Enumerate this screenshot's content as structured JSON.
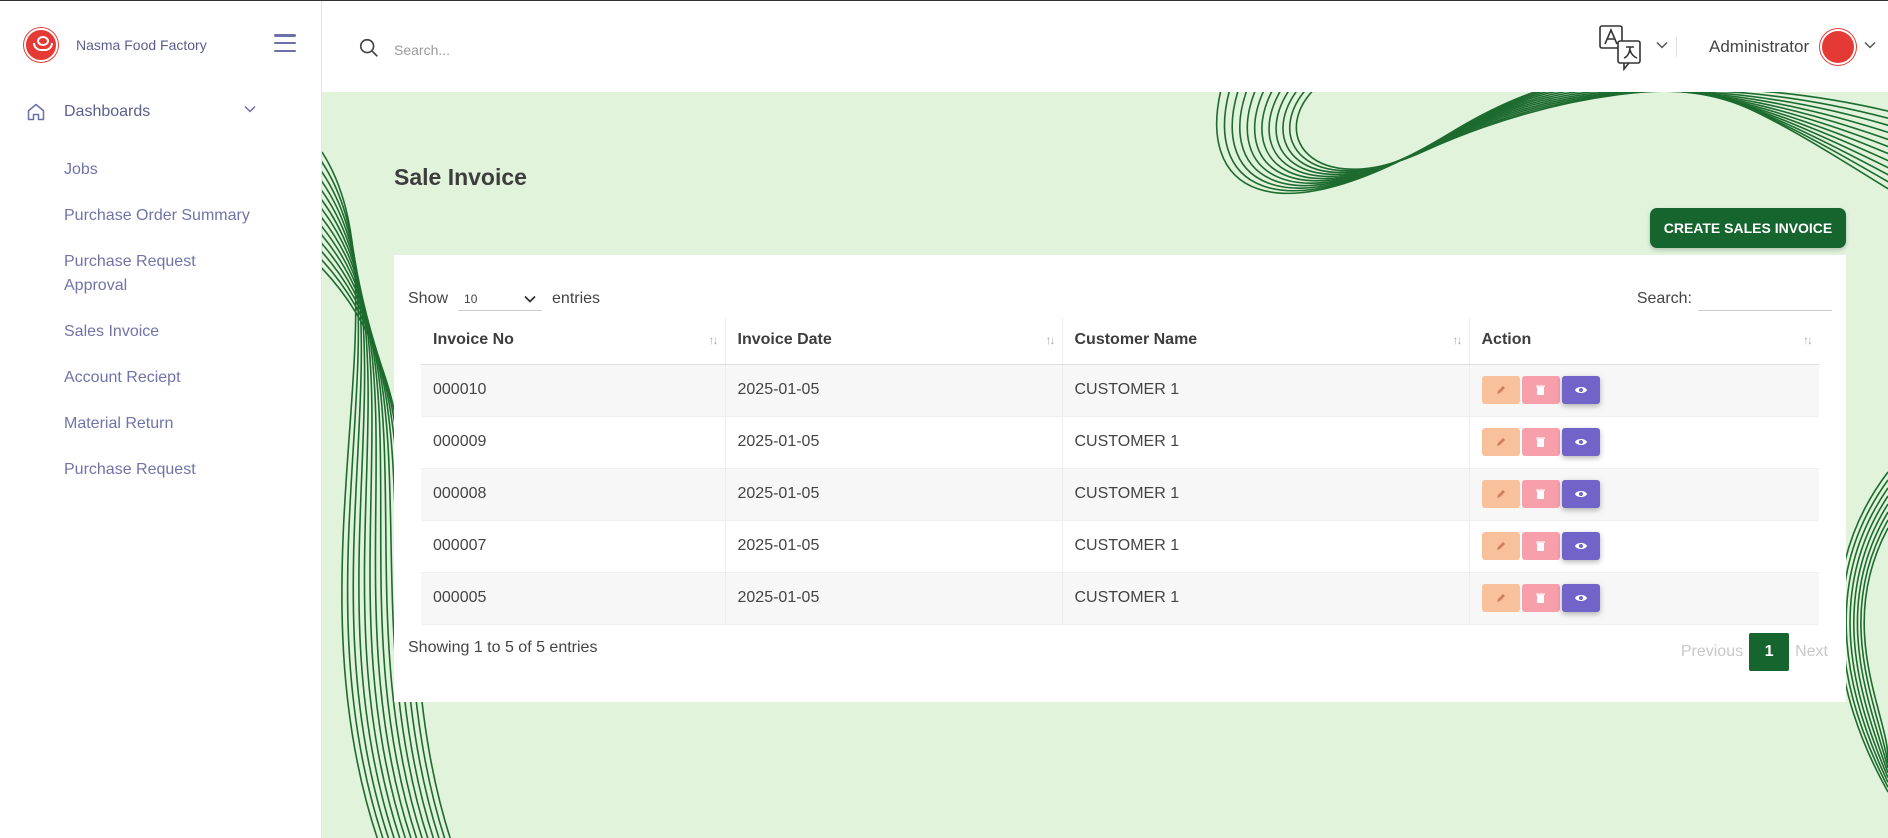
{
  "brand": {
    "name": "Nasma Food Factory"
  },
  "sidebar": {
    "dashboards_label": "Dashboards",
    "items": [
      {
        "label": "Jobs"
      },
      {
        "label": "Purchase Order Summary"
      },
      {
        "label": "Purchase Request Approval"
      },
      {
        "label": "Sales Invoice"
      },
      {
        "label": "Account Reciept"
      },
      {
        "label": "Material Return"
      },
      {
        "label": "Purchase Request"
      }
    ]
  },
  "header": {
    "search_placeholder": "Search...",
    "user_name": "Administrator",
    "language_icon": "translate-icon"
  },
  "page": {
    "title": "Sale Invoice",
    "create_button": "CREATE SALES INVOICE"
  },
  "table": {
    "show_label": "Show",
    "entries_value": "10",
    "entries_label": "entries",
    "search_label": "Search:",
    "columns": [
      "Invoice No",
      "Invoice Date",
      "Customer Name",
      "Action"
    ],
    "rows": [
      {
        "invoice_no": "000010",
        "date": "2025-01-05",
        "customer": "CUSTOMER 1"
      },
      {
        "invoice_no": "000009",
        "date": "2025-01-05",
        "customer": "CUSTOMER 1"
      },
      {
        "invoice_no": "000008",
        "date": "2025-01-05",
        "customer": "CUSTOMER 1"
      },
      {
        "invoice_no": "000007",
        "date": "2025-01-05",
        "customer": "CUSTOMER 1"
      },
      {
        "invoice_no": "000005",
        "date": "2025-01-05",
        "customer": "CUSTOMER 1"
      }
    ],
    "info": "Showing 1 to 5 of 5 entries",
    "pagination": {
      "previous": "Previous",
      "current": "1",
      "next": "Next"
    }
  },
  "colors": {
    "primary": "#16652f",
    "background": "#e1f3db",
    "edit": "#f9c09c",
    "delete": "#f7a0ab",
    "view": "#7263c9"
  }
}
